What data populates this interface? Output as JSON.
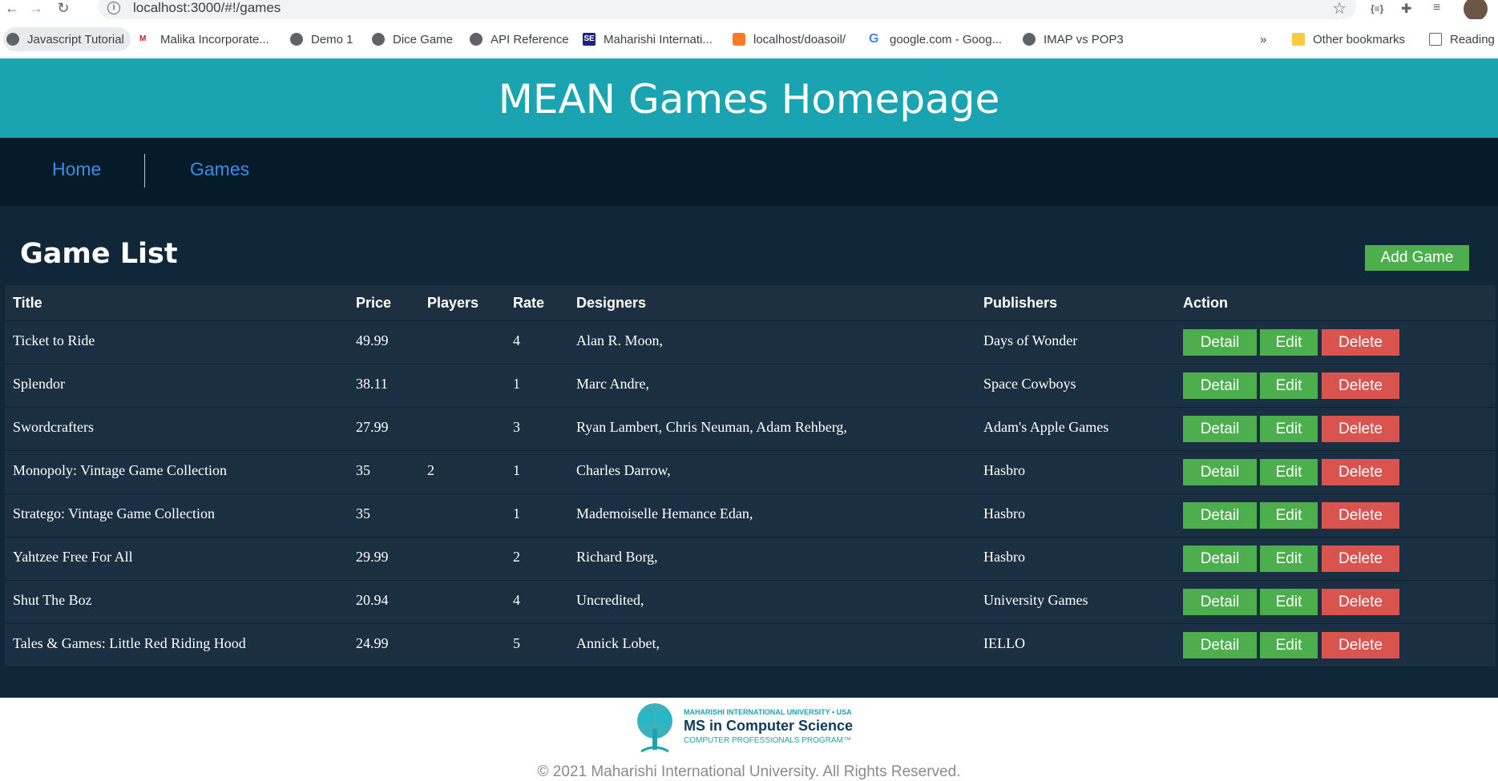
{
  "browser": {
    "url": "localhost:3000/#!/games",
    "bookmarks": [
      {
        "label": "Javascript Tutorial",
        "icon": "globe-icon"
      },
      {
        "label": "Malika Incorporate...",
        "icon": "gmail-icon"
      },
      {
        "label": "Demo 1",
        "icon": "globe-icon"
      },
      {
        "label": "Dice Game",
        "icon": "globe-icon"
      },
      {
        "label": "API Reference",
        "icon": "globe-icon"
      },
      {
        "label": "Maharishi Internati...",
        "icon": "se-icon"
      },
      {
        "label": "localhost/doasoil/",
        "icon": "xampp-icon"
      },
      {
        "label": "google.com - Goog...",
        "icon": "google-icon"
      },
      {
        "label": "IMAP vs POP3",
        "icon": "globe-icon"
      }
    ],
    "overflow_label": "»",
    "other_bookmarks": "Other bookmarks",
    "reading_list": "Reading"
  },
  "header": {
    "title": "MEAN Games Homepage"
  },
  "nav": {
    "home": "Home",
    "games": "Games"
  },
  "main": {
    "list_title": "Game List",
    "add_button": "Add Game",
    "columns": {
      "title": "Title",
      "price": "Price",
      "players": "Players",
      "rate": "Rate",
      "designers": "Designers",
      "publishers": "Publishers",
      "action": "Action"
    },
    "action_labels": {
      "detail": "Detail",
      "edit": "Edit",
      "delete": "Delete"
    },
    "rows": [
      {
        "title": "Ticket to Ride",
        "price": "49.99",
        "players": "",
        "rate": "4",
        "designers": "Alan R. Moon,",
        "publishers": "Days of Wonder"
      },
      {
        "title": "Splendor",
        "price": "38.11",
        "players": "",
        "rate": "1",
        "designers": "Marc Andre,",
        "publishers": "Space Cowboys"
      },
      {
        "title": "Swordcrafters",
        "price": "27.99",
        "players": "",
        "rate": "3",
        "designers": "Ryan Lambert, Chris Neuman, Adam Rehberg,",
        "publishers": "Adam's Apple Games"
      },
      {
        "title": "Monopoly: Vintage Game Collection",
        "price": "35",
        "players": "2",
        "rate": "1",
        "designers": "Charles Darrow,",
        "publishers": "Hasbro"
      },
      {
        "title": "Stratego: Vintage Game Collection",
        "price": "35",
        "players": "",
        "rate": "1",
        "designers": "Mademoiselle Hemance Edan,",
        "publishers": "Hasbro"
      },
      {
        "title": "Yahtzee Free For All",
        "price": "29.99",
        "players": "",
        "rate": "2",
        "designers": "Richard Borg,",
        "publishers": "Hasbro"
      },
      {
        "title": "Shut The Boz",
        "price": "20.94",
        "players": "",
        "rate": "4",
        "designers": "Uncredited,",
        "publishers": "University Games"
      },
      {
        "title": "Tales & Games: Little Red Riding Hood",
        "price": "24.99",
        "players": "",
        "rate": "5",
        "designers": "Annick Lobet,",
        "publishers": "IELLO"
      }
    ]
  },
  "footer": {
    "logo_line1": "MAHARISHI INTERNATIONAL UNIVERSITY • USA",
    "logo_line2": "MS in Computer Science",
    "logo_line3": "COMPUTER PROFESSIONALS PROGRAM™",
    "copyright": "© 2021 Maharishi International University. All Rights Reserved."
  },
  "colors": {
    "header_bg": "#1aa3b0",
    "nav_bg": "#061b2a",
    "main_bg": "#10273a",
    "success": "#4cae4c",
    "danger": "#d9534f",
    "link": "#3b8ee6"
  }
}
